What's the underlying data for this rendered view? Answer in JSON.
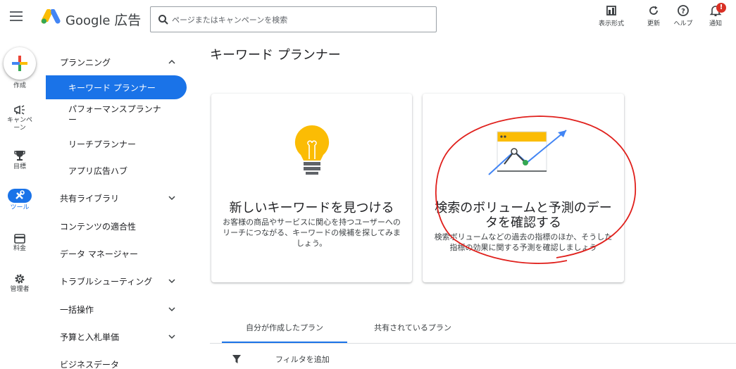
{
  "header": {
    "brand_name": "Google",
    "brand_suffix": "広告",
    "search_placeholder": "ページまたはキャンペーンを検索",
    "tools": [
      {
        "label": "表示形式",
        "icon": "appearance-icon"
      },
      {
        "label": "更新",
        "icon": "refresh-icon"
      },
      {
        "label": "ヘルプ",
        "icon": "help-icon"
      },
      {
        "label": "通知",
        "icon": "bell-icon",
        "badge": "!"
      }
    ]
  },
  "rail": {
    "create": "作成",
    "campaigns": "キャンペーン",
    "goals": "目標",
    "tools": "ツール",
    "billing": "料金",
    "admin": "管理者"
  },
  "nav": {
    "planning": "プランニング",
    "keyword_planner": "キーワード プランナー",
    "performance_planner": "パフォーマンスプランナー",
    "reach_planner": "リーチプランナー",
    "app_ad_hub": "アプリ広告ハブ",
    "shared_library": "共有ライブラリ",
    "content_suitability": "コンテンツの適合性",
    "data_manager": "データ マネージャー",
    "troubleshooting": "トラブルシューティング",
    "bulk_actions": "一括操作",
    "budgets_bids": "予算と入札単価",
    "business_data": "ビジネスデータ"
  },
  "main": {
    "title": "キーワード プランナー",
    "cards": [
      {
        "title": "新しいキーワードを見つける",
        "description": "お客様の商品やサービスに関心を持つユーザーへのリーチにつながる、キーワードの候補を探してみましょう。"
      },
      {
        "title": "検索のボリュームと予測のデータを確認する",
        "description": "検索ボリュームなどの過去の指標のほか、そうした指標の効果に関する予測を確認しましょう"
      }
    ],
    "tabs": [
      "自分が作成したプラン",
      "共有されているプラン"
    ],
    "filter_label": "フィルタを追加"
  },
  "colors": {
    "accent": "#1a73e8",
    "annotation": "#e0201c",
    "bulb": "#fbbc04",
    "badge": "#d93025"
  }
}
